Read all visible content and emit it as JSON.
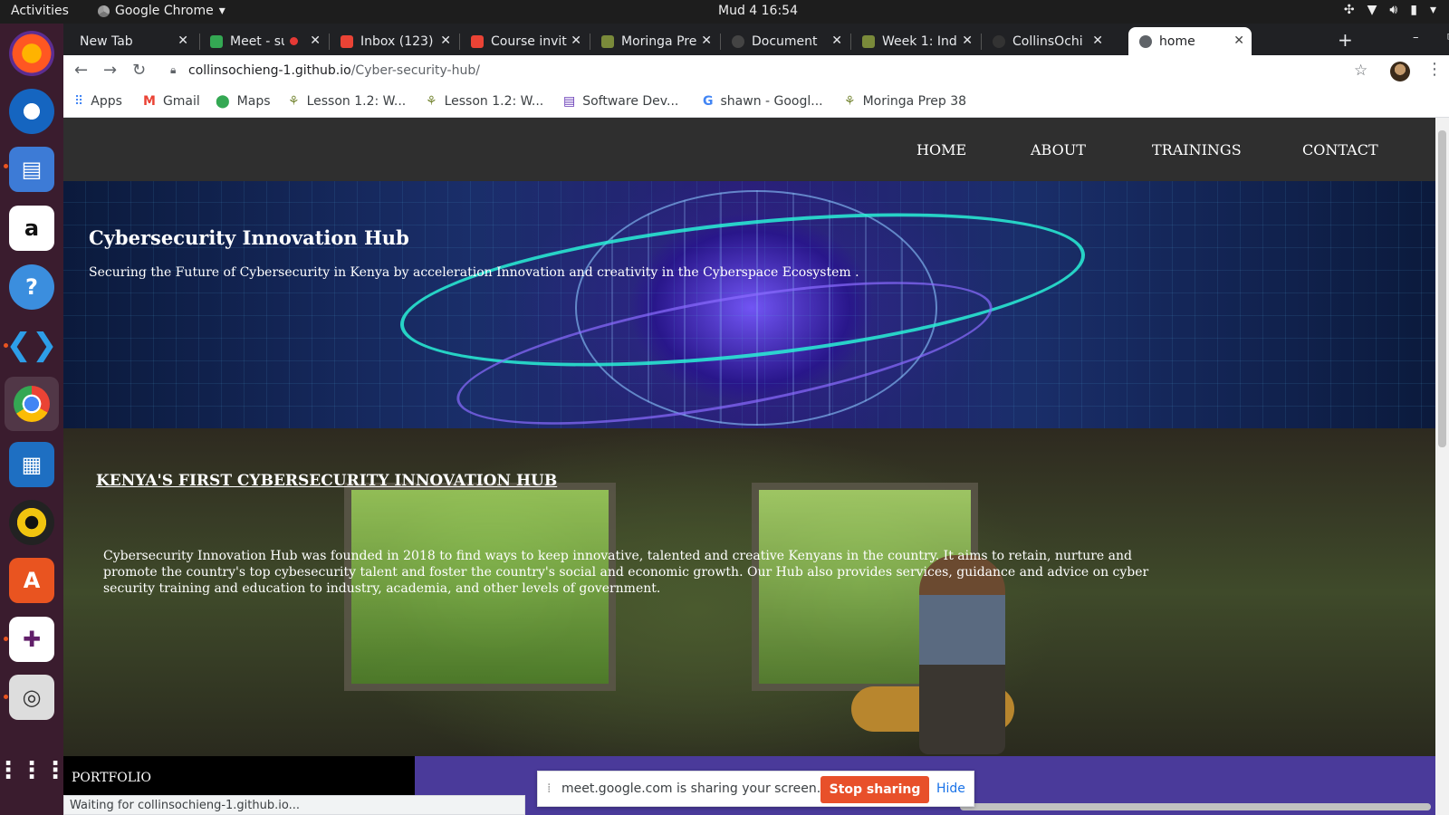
{
  "os": {
    "activities": "Activities",
    "app_name": "Google Chrome",
    "clock": "Mud 4  16:54"
  },
  "tabs": [
    {
      "label": "New Tab",
      "favicon_color": "#202124"
    },
    {
      "label": "Meet - su",
      "favicon_color": "#34a853"
    },
    {
      "label": "Inbox (123)",
      "favicon_color": "#ea4335"
    },
    {
      "label": "Course invit",
      "favicon_color": "#ea4335"
    },
    {
      "label": "Moringa Pre",
      "favicon_color": "#7a8a3a"
    },
    {
      "label": "Document",
      "favicon_color": "#444444"
    },
    {
      "label": "Week 1: Ind",
      "favicon_color": "#7a8a3a"
    },
    {
      "label": "CollinsOchi",
      "favicon_color": "#333333"
    },
    {
      "label": "home",
      "favicon_color": "#5f6368"
    }
  ],
  "toolbar": {
    "url_host": "collinsochieng-1.github.io",
    "url_path": "/Cyber-security-hub/"
  },
  "bookmarks": [
    {
      "label": "Apps",
      "icon": "apps-grid-icon"
    },
    {
      "label": "Gmail",
      "icon": "gmail-icon"
    },
    {
      "label": "Maps",
      "icon": "maps-pin-icon"
    },
    {
      "label": "Lesson 1.2: W...",
      "icon": "moringa-icon"
    },
    {
      "label": "Lesson 1.2: W...",
      "icon": "moringa-icon"
    },
    {
      "label": "Software Dev...",
      "icon": "forms-icon"
    },
    {
      "label": "shawn - Googl...",
      "icon": "google-icon"
    },
    {
      "label": "Moringa Prep 38",
      "icon": "moringa-icon"
    }
  ],
  "site": {
    "nav": [
      "HOME",
      "ABOUT",
      "TRAININGS",
      "CONTACT"
    ],
    "hero_title": "Cybersecurity Innovation Hub",
    "hero_subtitle": "Securing the Future of Cybersecurity in Kenya by acceleration Innovation and creativity in the Cyberspace Ecosystem .",
    "about_title": "KENYA'S FIRST CYBERSECURITY INNOVATION HUB",
    "about_body": "Cybersecurity Innovation Hub was founded in 2018 to find ways to keep innovative, talented and creative Kenyans in the country. It aims to retain, nurture and promote the country's top cybesecurity talent and foster the country's social and economic growth. Our Hub also provides services, guidance and advice on cyber security training and education to industry, academia, and other levels of government.",
    "portfolio_label": "PORTFOLIO"
  },
  "status": "Waiting for collinsochieng-1.github.io...",
  "share": {
    "message": "meet.google.com is sharing your screen.",
    "stop_label": "Stop sharing",
    "hide_label": "Hide"
  },
  "colors": {
    "accent": "#e8502a",
    "link": "#1a73e8",
    "dock_bg": "#3a1c2e"
  }
}
